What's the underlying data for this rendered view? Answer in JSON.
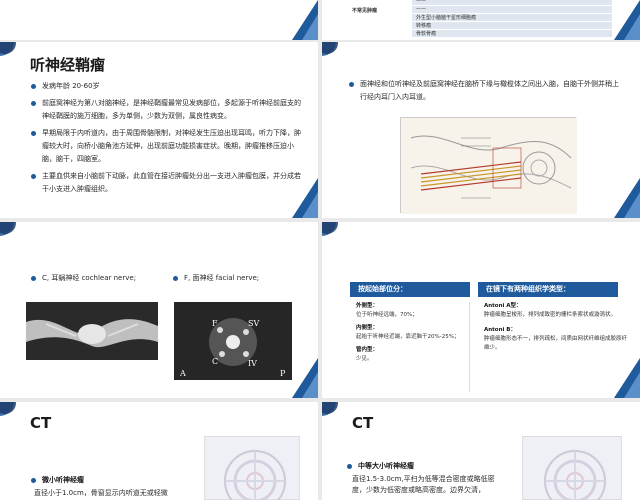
{
  "slide_top_left": {},
  "slide_top_right": {
    "table": [
      {
        "label": "",
        "value": "——"
      },
      {
        "label": "不常见肿瘤",
        "value": "——"
      },
      {
        "label": "",
        "value": "外生型小脑脑干星形细胞瘤"
      },
      {
        "label": "",
        "value": "转移瘤"
      },
      {
        "label": "",
        "value": "骨软骨瘤"
      }
    ]
  },
  "slide_acoustic": {
    "title": "听神经鞘瘤",
    "bullets": [
      "发病年龄  20-60岁",
      "前庭窝神经为第八对脑神经，是神经鞘瘤最常见发病部位，多起源于听神经前庭支的神经鞘膜的施万细胞，多为单侧，少数为双侧，属良性病变。",
      "早期局限于内听道内，由于周围骨骼限制，对神经发生压迫出现耳鸣，听力下降，肿瘤较大时，向桥小脑角池方延伸，出现前庭功能损害症状。晚期，肿瘤推移压迫小脑，脑干，四脑室。",
      "主要血供来自小脑前下动脉，此血管在接近肿瘤处分出一支进入肿瘤包膜，并分成若干小支进入肿瘤组织。"
    ]
  },
  "slide_anatomy": {
    "text": "面神经和位听神经及前庭窝神经在脑桥下缘与橄榄体之间出入脑，自脑干外侧并稍上行经内耳门入内耳道。"
  },
  "slide_nerves": {
    "left_caption": "C, 耳蜗神经 cochlear nerve;",
    "right_caption": "F, 面神经 facial nerve;",
    "image_labels": [
      "F",
      "SV",
      "C",
      "IV",
      "A",
      "P"
    ]
  },
  "slide_classification": {
    "left_head": "按起始部位分：",
    "left_items": [
      {
        "bold": "外侧型：",
        "text": "位于听神经远端，70%；"
      },
      {
        "bold": "内侧型：",
        "text": "起始于听神经近端，靠近脑干20%-25%；"
      },
      {
        "bold": "管内型：",
        "text": "少见。"
      }
    ],
    "right_head": "在镜下有两种组织学类型：",
    "right_items": [
      {
        "bold": "Antoni A型：",
        "text": "肿瘤细胞呈梭形，排列成致密的栅栏条索状或漩涡状。"
      },
      {
        "bold": "Antoni B：",
        "text": "肿瘤细胞形态不一，排列疏松，间质由网状纤维组成胶原纤维少。"
      }
    ]
  },
  "slide_ct_small": {
    "title": "CT",
    "subtitle": "微小听神经瘤",
    "text": "直径小于1.0cm，骨窗显示内听道无或轻微"
  },
  "slide_ct_medium": {
    "title": "CT",
    "subtitle": "中等大小听神经瘤",
    "text": "直径1.5-3.0cm,平扫为低等混合密度或略低密度，少数为低密度或略高密度。边界欠清，"
  },
  "colors": {
    "accent": "#1e5a9c",
    "dark": "#1d3d6b"
  }
}
